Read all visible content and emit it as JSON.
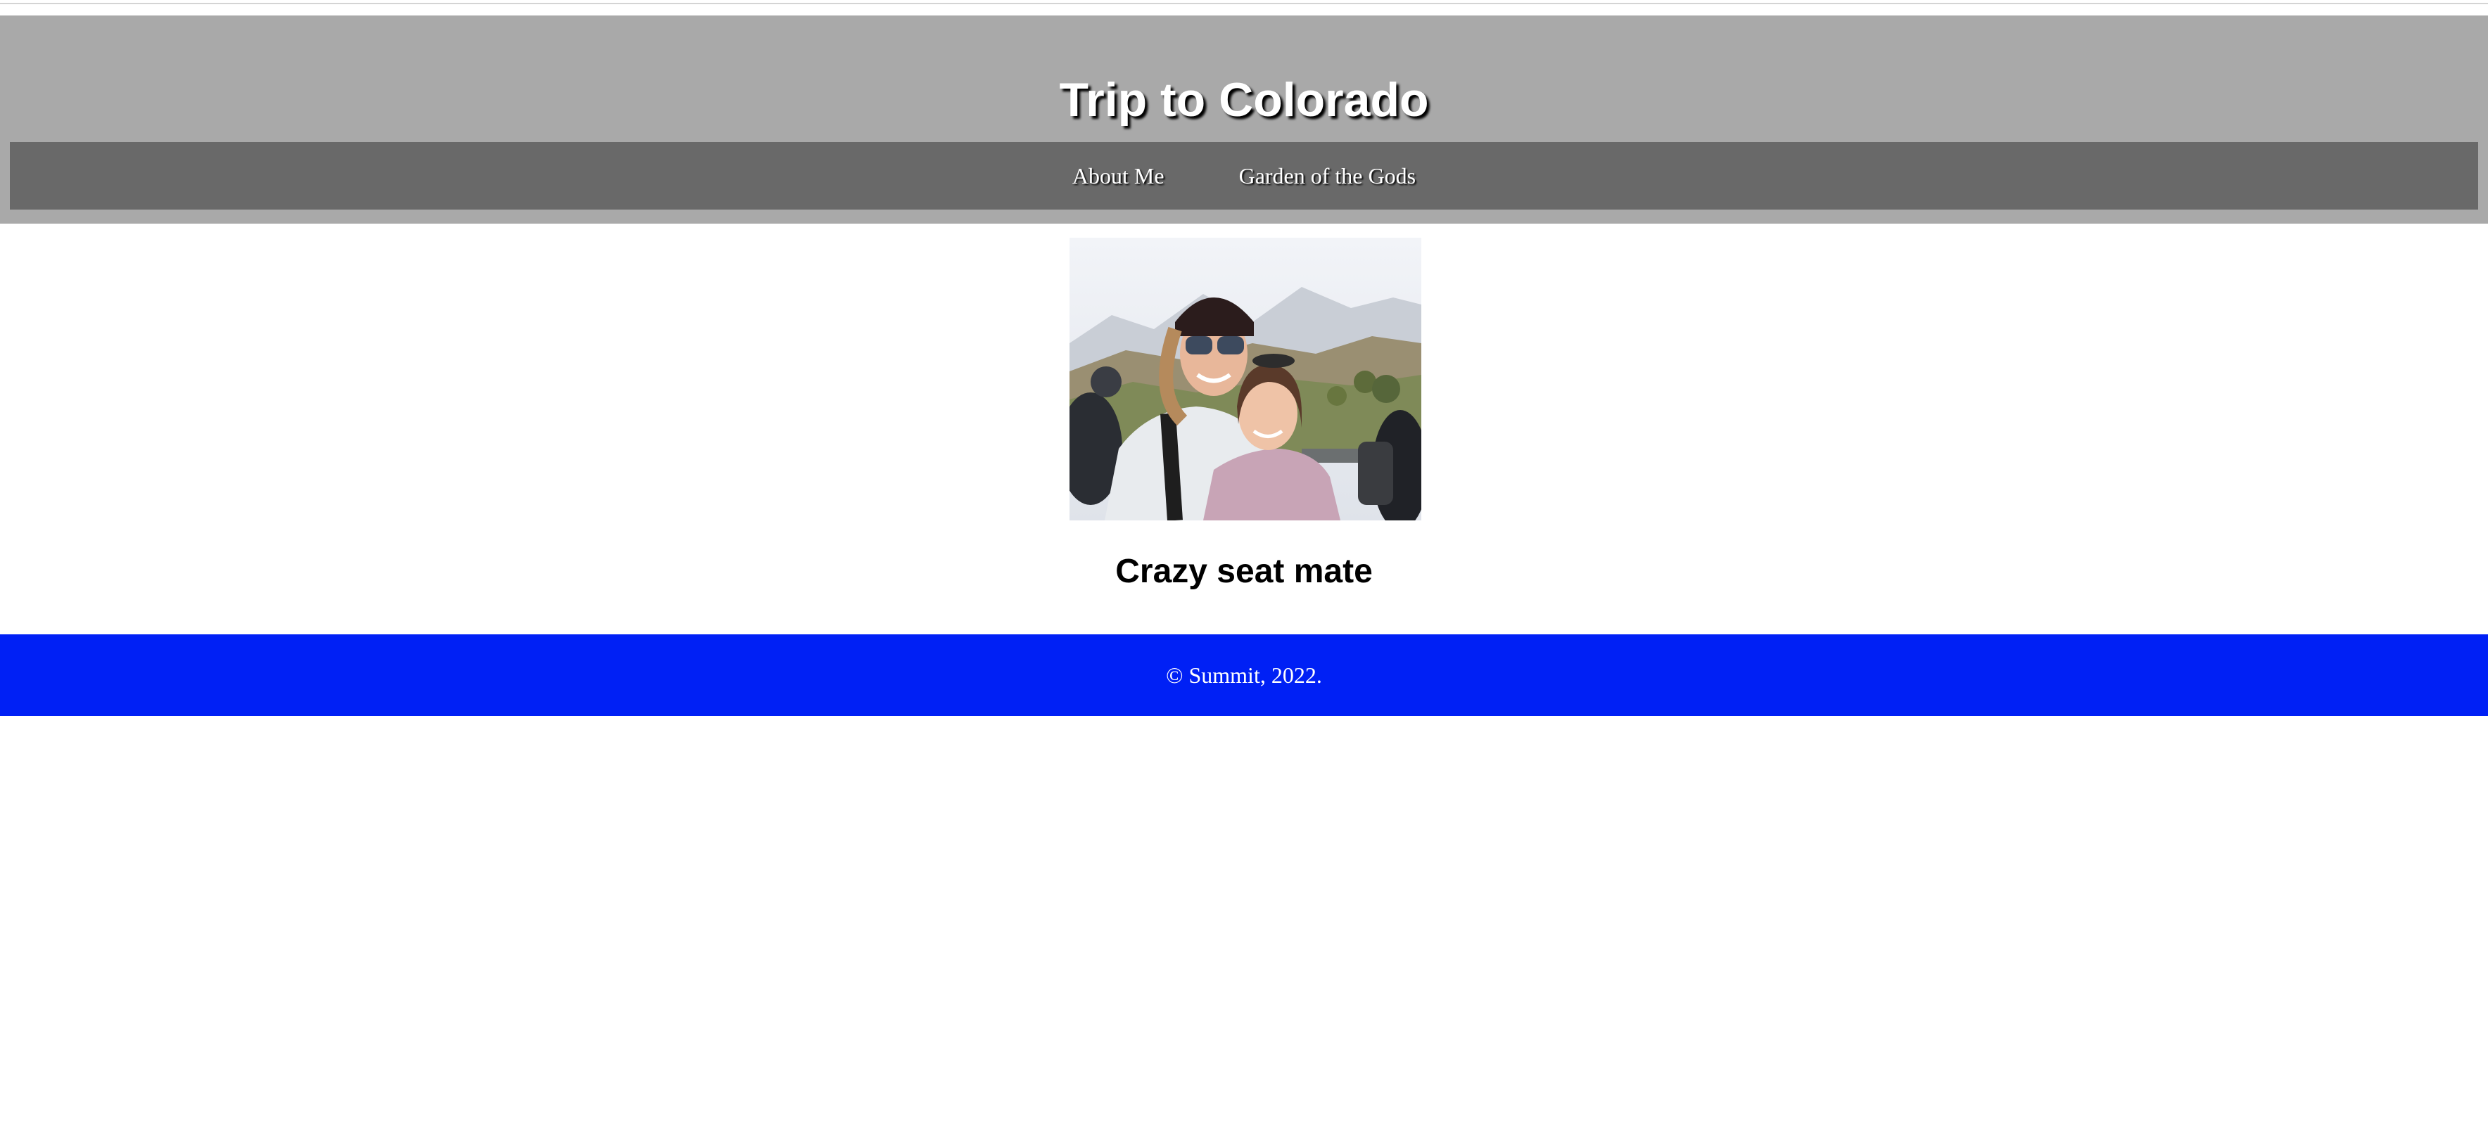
{
  "header": {
    "title": "Trip to Colorado",
    "background": "#a9a9a9"
  },
  "nav": {
    "background": "#696969",
    "items": [
      {
        "label": "About Me"
      },
      {
        "label": "Garden of the Gods"
      }
    ]
  },
  "main": {
    "photo": {
      "icon": "photo-of-two-friends"
    },
    "caption": "Crazy seat mate"
  },
  "footer": {
    "text": "© Summit, 2022.",
    "background": "#0020f5"
  }
}
